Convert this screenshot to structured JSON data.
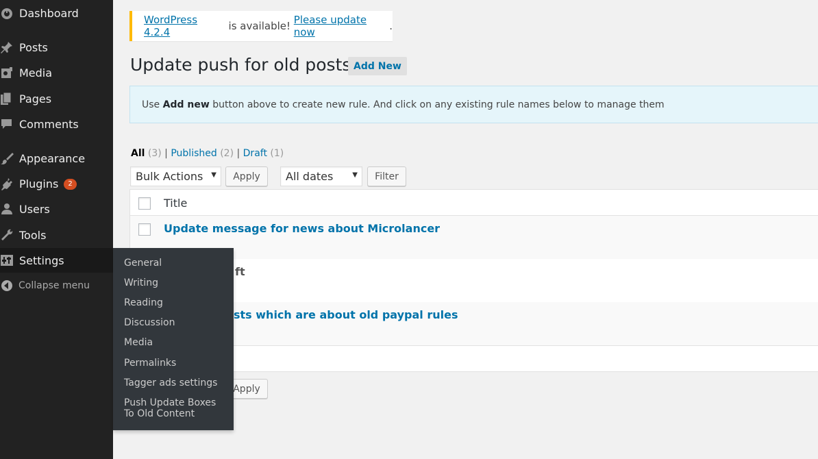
{
  "sidebar": {
    "items": [
      {
        "label": "Dashboard",
        "icon": "dashboard-icon"
      },
      {
        "label": "Posts",
        "icon": "pin-icon"
      },
      {
        "label": "Media",
        "icon": "media-icon"
      },
      {
        "label": "Pages",
        "icon": "pages-icon"
      },
      {
        "label": "Comments",
        "icon": "comment-icon"
      },
      {
        "label": "Appearance",
        "icon": "paintbrush-icon"
      },
      {
        "label": "Plugins",
        "icon": "plugin-icon",
        "badge": "2"
      },
      {
        "label": "Users",
        "icon": "user-icon"
      },
      {
        "label": "Tools",
        "icon": "wrench-icon"
      },
      {
        "label": "Settings",
        "icon": "settings-icon"
      }
    ],
    "collapse_label": "Collapse menu"
  },
  "settings_submenu": {
    "items": [
      "General",
      "Writing",
      "Reading",
      "Discussion",
      "Media",
      "Permalinks",
      "Tagger ads settings",
      "Push Update Boxes To Old Content"
    ]
  },
  "notice": {
    "version_link": "WordPress 4.2.4",
    "middle_text": " is available! ",
    "update_link": "Please update now",
    "end_text": "."
  },
  "page": {
    "title": "Update push for old posts",
    "add_new": "Add New"
  },
  "info": {
    "prefix": "Use ",
    "bold": "Add new",
    "suffix": " button above to create new rule. And click on any existing rule names below to manage them"
  },
  "filters": {
    "all_label": "All",
    "all_count": " (3)",
    "sep": " | ",
    "published_label": "Published",
    "published_count": " (2)",
    "draft_label": "Draft",
    "draft_count": " (1)"
  },
  "tablenav": {
    "bulk_actions": "Bulk Actions",
    "apply": "Apply",
    "dates": "All dates",
    "filter": "Filter"
  },
  "table": {
    "header_title": "Title",
    "rows": [
      {
        "title": "Update message for news about Microlancer"
      },
      {
        "title_visible": "ft"
      },
      {
        "title_visible": "sts which are about old paypal rules"
      }
    ]
  },
  "colors": {
    "sidebar_bg": "#222222",
    "submenu_bg": "#32373c",
    "link": "#0073aa",
    "notice_border": "#ffba00",
    "badge": "#d54e21"
  }
}
